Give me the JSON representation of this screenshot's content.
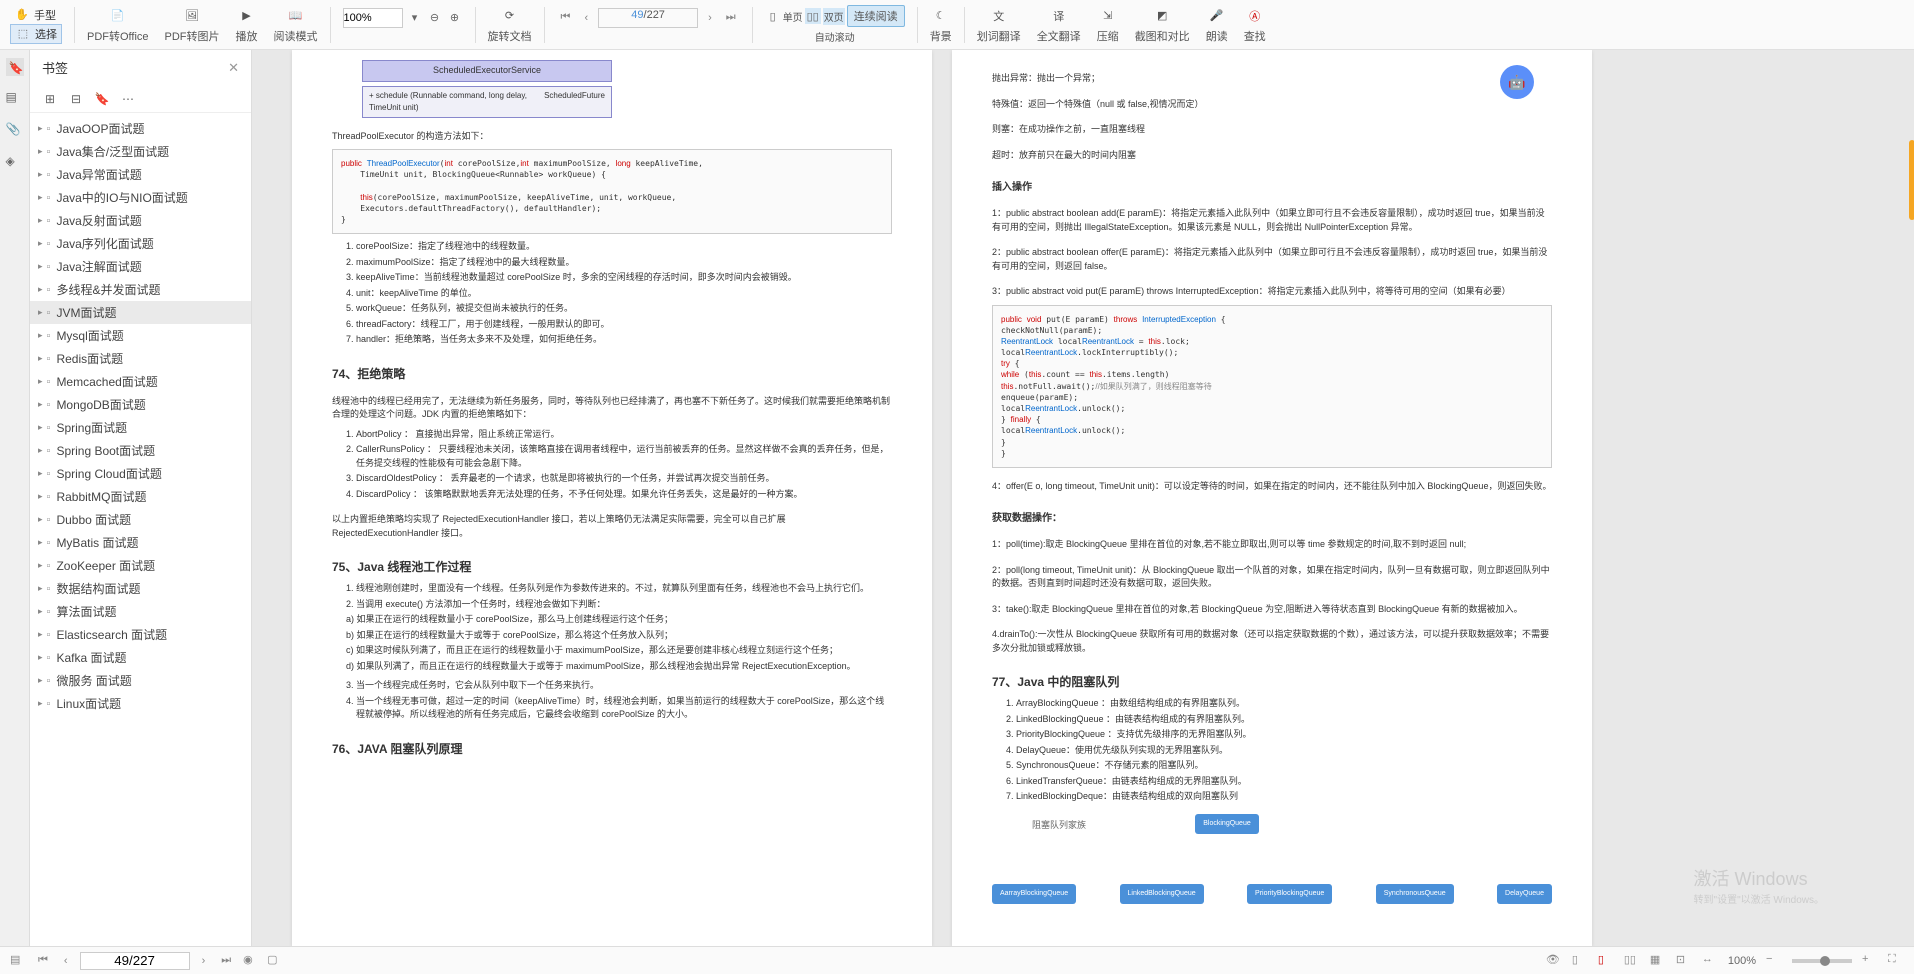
{
  "toolbar": {
    "hand": "手型",
    "select": "选择",
    "pdf_to_office": "PDF转Office",
    "pdf_to_image": "PDF转图片",
    "play": "播放",
    "read_mode": "阅读模式",
    "zoom": "100%",
    "rotate": "旋转文档",
    "single": "单页",
    "double": "双页",
    "continuous": "连续阅读",
    "auto_scroll": "自动滚动",
    "page_current": "49",
    "page_total": "/227",
    "background": "背景",
    "word_translate": "划词翻译",
    "full_translate": "全文翻译",
    "compress": "压缩",
    "screenshot_compare": "截图和对比",
    "read_aloud": "朗读",
    "find": "查找"
  },
  "sidebar": {
    "title": "书签",
    "items": [
      {
        "label": "JavaOOP面试题"
      },
      {
        "label": "Java集合/泛型面试题"
      },
      {
        "label": "Java异常面试题"
      },
      {
        "label": "Java中的IO与NIO面试题"
      },
      {
        "label": "Java反射面试题"
      },
      {
        "label": "Java序列化面试题"
      },
      {
        "label": "Java注解面试题"
      },
      {
        "label": "多线程&并发面试题"
      },
      {
        "label": "JVM面试题",
        "active": true
      },
      {
        "label": "Mysql面试题"
      },
      {
        "label": "Redis面试题"
      },
      {
        "label": "Memcached面试题"
      },
      {
        "label": "MongoDB面试题"
      },
      {
        "label": "Spring面试题"
      },
      {
        "label": "Spring Boot面试题"
      },
      {
        "label": "Spring Cloud面试题"
      },
      {
        "label": "RabbitMQ面试题"
      },
      {
        "label": "Dubbo 面试题"
      },
      {
        "label": "MyBatis 面试题"
      },
      {
        "label": "ZooKeeper 面试题"
      },
      {
        "label": "数据结构面试题"
      },
      {
        "label": "算法面试题"
      },
      {
        "label": "Elasticsearch 面试题"
      },
      {
        "label": "Kafka 面试题"
      },
      {
        "label": "微服务 面试题"
      },
      {
        "label": "Linux面试题"
      }
    ]
  },
  "page_left": {
    "dia_header": "ScheduledExecutorService",
    "dia_method": "+ schedule (Runnable command, long delay, TimeUnit unit)",
    "dia_return": "ScheduledFuture",
    "constructor_note": "ThreadPoolExecutor 的构造方法如下：",
    "code1_l1": "public ThreadPoolExecutor(int corePoolSize,int maximumPoolSize, long keepAliveTime,",
    "code1_l2": "    TimeUnit unit, BlockingQueue<Runnable> workQueue) {",
    "code1_l3": "",
    "code1_l4": "    this(corePoolSize, maximumPoolSize, keepAliveTime, unit, workQueue,",
    "code1_l5": "    Executors.defaultThreadFactory(), defaultHandler);",
    "code1_l6": "}",
    "params": [
      "corePoolSize：指定了线程池中的线程数量。",
      "maximumPoolSize：指定了线程池中的最大线程数量。",
      "keepAliveTime：当前线程池数量超过 corePoolSize 时，多余的空闲线程的存活时间，即多次时间内会被销毁。",
      "unit：keepAliveTime 的单位。",
      "workQueue：任务队列，被提交但尚未被执行的任务。",
      "threadFactory：线程工厂，用于创建线程，一般用默认的即可。",
      "handler：拒绝策略，当任务太多来不及处理，如何拒绝任务。"
    ],
    "h74": "74、拒绝策略",
    "reject_intro": "线程池中的线程已经用完了，无法继续为新任务服务，同时，等待队列也已经排满了，再也塞不下新任务了。这时候我们就需要拒绝策略机制合理的处理这个问题。JDK 内置的拒绝策略如下：",
    "reject_list": [
      "AbortPolicy ： 直接抛出异常，阻止系统正常运行。",
      "CallerRunsPolicy ： 只要线程池未关闭，该策略直接在调用者线程中，运行当前被丢弃的任务。显然这样做不会真的丢弃任务，但是，任务提交线程的性能极有可能会急剧下降。",
      "DiscardOldestPolicy ： 丢弃最老的一个请求，也就是即将被执行的一个任务，并尝试再次提交当前任务。",
      "DiscardPolicy ： 该策略默默地丢弃无法处理的任务，不予任何处理。如果允许任务丢失，这是最好的一种方案。"
    ],
    "reject_note": "以上内置拒绝策略均实现了 RejectedExecutionHandler 接口，若以上策略仍无法满足实际需要，完全可以自己扩展 RejectedExecutionHandler 接口。",
    "h75": "75、Java 线程池工作过程",
    "work_list": [
      "线程池刚创建时，里面没有一个线程。任务队列是作为参数传进来的。不过，就算队列里面有任务，线程池也不会马上执行它们。",
      "当调用 execute() 方法添加一个任务时，线程池会做如下判断："
    ],
    "work_sub": [
      "a) 如果正在运行的线程数量小于 corePoolSize，那么马上创建线程运行这个任务；",
      "b) 如果正在运行的线程数量大于或等于 corePoolSize，那么将这个任务放入队列；",
      "c) 如果这时候队列满了，而且正在运行的线程数量小于 maximumPoolSize，那么还是要创建非核心线程立刻运行这个任务；",
      "d) 如果队列满了，而且正在运行的线程数量大于或等于 maximumPoolSize，那么线程池会抛出异常 RejectExecutionException。"
    ],
    "work_list2": [
      "当一个线程完成任务时，它会从队列中取下一个任务来执行。",
      "当一个线程无事可做，超过一定的时间（keepAliveTime）时，线程池会判断，如果当前运行的线程数大于 corePoolSize，那么这个线程就被停掉。所以线程池的所有任务完成后，它最终会收缩到 corePoolSize 的大小。"
    ],
    "h76": "76、JAVA 阻塞队列原理"
  },
  "page_right": {
    "exc_lines": [
      "抛出异常：抛出一个异常；",
      "特殊值：返回一个特殊值（null 或 false,视情况而定）",
      "则塞：在成功操作之前，一直阻塞线程",
      "超时：放弃前只在最大的时间内阻塞"
    ],
    "insert_h": "插入操作",
    "insert_list": [
      "1：public abstract boolean add(E paramE)：将指定元素插入此队列中（如果立即可行且不会违反容量限制），成功时返回 true，如果当前没有可用的空间，则抛出 IllegalStateException。如果该元素是 NULL，则会抛出 NullPointerException 异常。",
      "2：public abstract boolean offer(E paramE)：将指定元素插入此队列中（如果立即可行且不会违反容量限制），成功时返回 true，如果当前没有可用的空间，则返回 false。",
      "3：public abstract void put(E paramE) throws InterruptedException：将指定元素插入此队列中，将等待可用的空间（如果有必要）"
    ],
    "code2": [
      "public void put(E paramE) throws InterruptedException {",
      "    checkNotNull(paramE);",
      "    ReentrantLock localReentrantLock = this.lock;",
      "    localReentrantLock.lockInterruptibly();",
      "    try {",
      "        while (this.count == this.items.length)",
      "        this.notFull.await();//如果队列满了，则线程阻塞等待",
      "        enqueue(paramE);",
      "        localReentrantLock.unlock();",
      "    } finally {",
      "        localReentrantLock.unlock();",
      "    }",
      "}"
    ],
    "insert4": "4：offer(E o, long timeout, TimeUnit unit)：可以设定等待的时间，如果在指定的时间内，还不能往队列中加入 BlockingQueue，则返回失败。",
    "get_h": "获取数据操作：",
    "get_list": [
      "1：poll(time):取走 BlockingQueue 里排在首位的对象,若不能立即取出,则可以等 time 参数规定的时间,取不到时返回 null;",
      "2：poll(long timeout, TimeUnit unit)：从 BlockingQueue 取出一个队首的对象，如果在指定时间内，队列一旦有数据可取，则立即返回队列中的数据。否则直到时间超时还没有数据可取，返回失败。",
      "3：take():取走 BlockingQueue 里排在首位的对象,若 BlockingQueue 为空,阻断进入等待状态直到 BlockingQueue 有新的数据被加入。",
      "4.drainTo():一次性从 BlockingQueue 获取所有可用的数据对象（还可以指定获取数据的个数），通过该方法，可以提升获取数据效率；不需要多次分批加锁或释放锁。"
    ],
    "h77": "77、Java 中的阻塞队列",
    "queue_list": [
      "ArrayBlockingQueue ：由数组结构组成的有界阻塞队列。",
      "LinkedBlockingQueue ：由链表结构组成的有界阻塞队列。",
      "PriorityBlockingQueue ：支持优先级排序的无界阻塞队列。",
      "DelayQueue：使用优先级队列实现的无界阻塞队列。",
      "SynchronousQueue：不存储元素的阻塞队列。",
      "LinkedTransferQueue：由链表结构组成的无界阻塞队列。",
      "LinkedBlockingDeque：由链表结构组成的双向阻塞队列"
    ],
    "tree_label": "阻塞队列家族",
    "tree_root": "BlockingQueue",
    "tree_leaves": [
      "AarrayBlockingQueue",
      "LinkedBlockingQueue",
      "PriorityBlockingQueue",
      "SynchronousQueue",
      "DelayQueue"
    ]
  },
  "watermark": {
    "l1": "激活 Windows",
    "l2": "转到\"设置\"以激活 Windows。"
  },
  "statusbar": {
    "page": "49/227",
    "zoom": "100%"
  }
}
